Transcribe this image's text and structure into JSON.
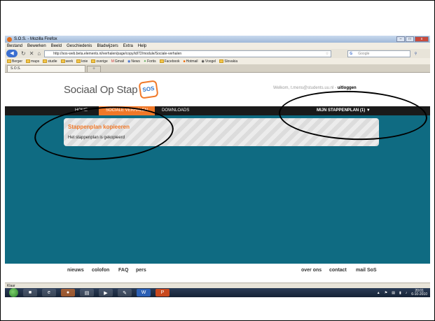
{
  "window": {
    "title": "S.O.S. - Mozilla Firefox",
    "controls": [
      "–",
      "□",
      "x"
    ]
  },
  "menu": [
    "Bestand",
    "Bewerken",
    "Beeld",
    "Geschiedenis",
    "Bladwijzers",
    "Extra",
    "Help"
  ],
  "nav": {
    "url": "http://sos-web.beta.elements.nl/verhalen/page/copy/id/72/module/Sociale-verhalen",
    "search_placeholder": "Google"
  },
  "bookmarks": [
    "Berger",
    "maps",
    "studie",
    "werk",
    "knie",
    "overige",
    "Gmail",
    "News",
    "Fortis",
    "Facebook",
    "Hotmail",
    "Voogel",
    "Slovakia"
  ],
  "tab": {
    "label": "S.O.S.",
    "new_tab": "+"
  },
  "site": {
    "logo_text": "Sociaal Op Stap",
    "logo_badge": "SOS",
    "welcome": "Welkom, t.mens@students.uu.nl - ",
    "logout": "uitloggen",
    "menu": [
      {
        "label": "HOME"
      },
      {
        "label": "SOCIALE VERHALEN"
      },
      {
        "label": "DOWNLOADS"
      }
    ],
    "mijn": "MIJN STAPPENPLAN (1) ▼"
  },
  "panel": {
    "title": "Stappenplan kopieeren",
    "message": "Het stappenplan is gekopieerd"
  },
  "footer": {
    "left": [
      "nieuws",
      "colofon",
      "FAQ",
      "pers"
    ],
    "right": [
      "over ons",
      "contact",
      "mail SoS"
    ]
  },
  "status": "Klaar",
  "taskbar": {
    "time": "20:01",
    "date": "6-10-2010"
  }
}
